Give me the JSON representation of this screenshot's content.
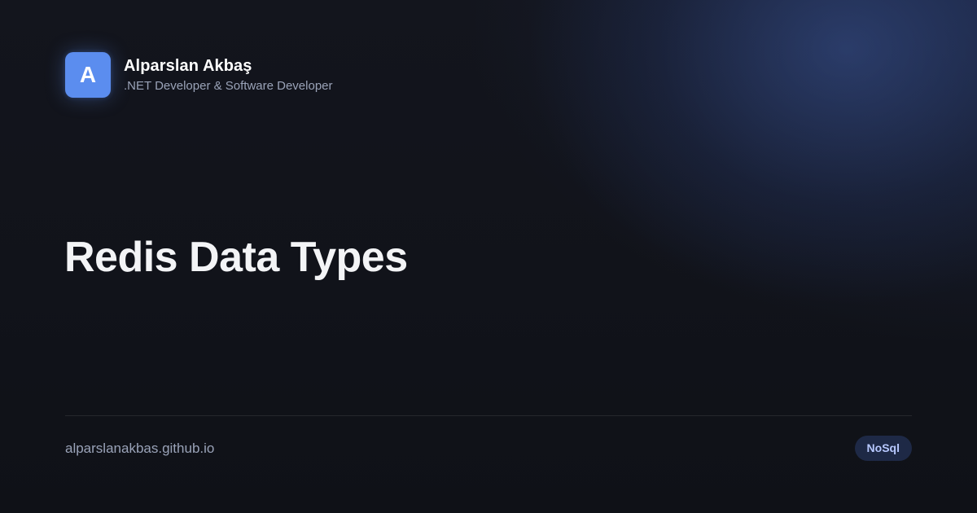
{
  "author": {
    "avatar_letter": "A",
    "name": "Alparslan Akbaş",
    "role": ".NET Developer & Software Developer"
  },
  "post": {
    "title": "Redis Data Types"
  },
  "footer": {
    "url": "alparslanakbas.github.io",
    "tag": "NoSql"
  },
  "colors": {
    "avatar": "#5b8def",
    "background": "#12141b",
    "title": "#f3f4f6",
    "muted_text": "#9aa3b8",
    "badge_bg": "#1e2946",
    "badge_text": "#b7c8ff"
  }
}
